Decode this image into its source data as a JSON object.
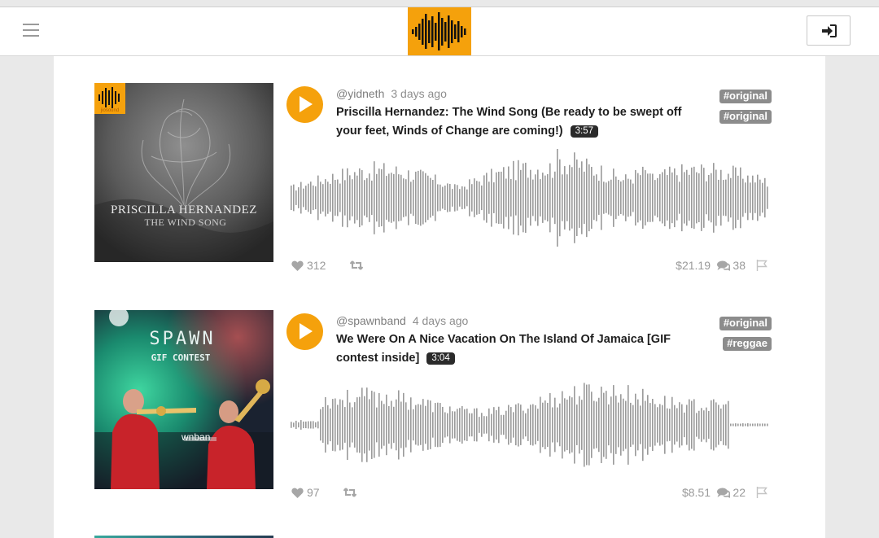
{
  "header": {
    "menu_icon": "hamburger-menu-icon",
    "logo_icon": "waveform-logo-icon",
    "login_icon": "sign-in-icon",
    "brand_color": "#f5a10c"
  },
  "posts": [
    {
      "handle": "@yidneth",
      "time": "3 days ago",
      "title": "Priscilla Hernandez: The Wind Song (Be ready to be swept off your feet, Winds of Change are coming!)",
      "duration": "3:57",
      "tags": [
        "#original",
        "#original"
      ],
      "likes": "312",
      "price": "$21.19",
      "comments": "38",
      "cover": {
        "artist": "Priscilla Hernandez",
        "album": "The Wind Song",
        "badge": "jiosound"
      }
    },
    {
      "handle": "@spawnband",
      "time": "4 days ago",
      "title": "We Were On A Nice Vacation On The Island Of Jamaica [GIF contest inside]",
      "duration": "3:04",
      "tags": [
        "#original",
        "#reggae"
      ],
      "likes": "97",
      "price": "$8.51",
      "comments": "22",
      "cover": {
        "artist": "SPAWN",
        "album": "GIF CONTEST",
        "banner": "wnban"
      }
    }
  ]
}
